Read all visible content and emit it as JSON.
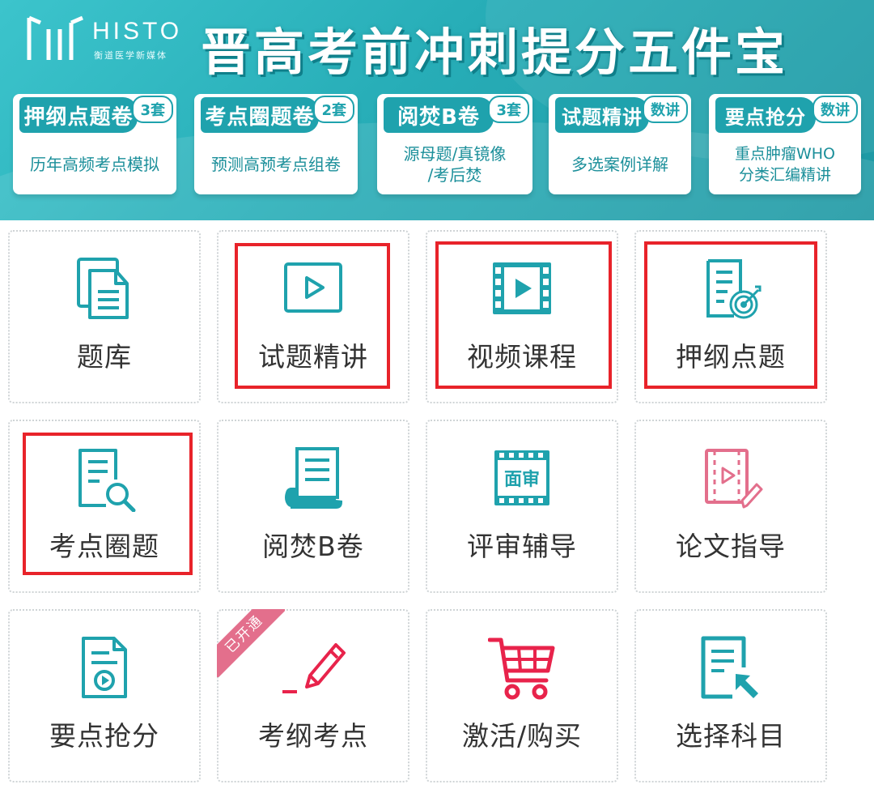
{
  "brand": {
    "name": "HISTO",
    "subtitle": "衡道医学新媒体"
  },
  "headline": "晋高考前冲刺提分五件宝",
  "promos": [
    {
      "title": "押纲点题卷",
      "badge": "3套",
      "desc": "历年高频考点模拟"
    },
    {
      "title": "考点圈题卷",
      "badge": "2套",
      "desc": "预测高预考点组卷"
    },
    {
      "title": "阅焚B卷",
      "badge": "3套",
      "desc_line1": "源母题/真镜像",
      "desc_line2": "/考后焚"
    },
    {
      "title": "试题精讲",
      "badge": "数讲",
      "desc": "多选案例详解"
    },
    {
      "title": "要点抢分",
      "badge": "数讲",
      "desc_line1": "重点肿瘤WHO",
      "desc_line2": "分类汇编精讲"
    }
  ],
  "grid": [
    {
      "label": "题库",
      "icon": "document-stack-icon"
    },
    {
      "label": "试题精讲",
      "icon": "play-square-icon"
    },
    {
      "label": "视频课程",
      "icon": "film-strip-icon"
    },
    {
      "label": "押纲点题",
      "icon": "target-document-icon"
    },
    {
      "label": "考点圈题",
      "icon": "search-document-icon"
    },
    {
      "label": "阅焚B卷",
      "icon": "scroll-icon"
    },
    {
      "label": "评审辅导",
      "icon": "review-film-icon",
      "icon_text": "面审"
    },
    {
      "label": "论文指导",
      "icon": "paper-video-icon"
    },
    {
      "label": "要点抢分",
      "icon": "audio-document-icon"
    },
    {
      "label": "考纲考点",
      "icon": "pencil-icon",
      "ribbon": "已开通"
    },
    {
      "label": "激活/购买",
      "icon": "shopping-cart-icon"
    },
    {
      "label": "选择科目",
      "icon": "select-cursor-icon"
    }
  ],
  "colors": {
    "teal": "#1fa2ad",
    "pink": "#e36f8c",
    "red": "#e8232a",
    "text": "#333333"
  }
}
